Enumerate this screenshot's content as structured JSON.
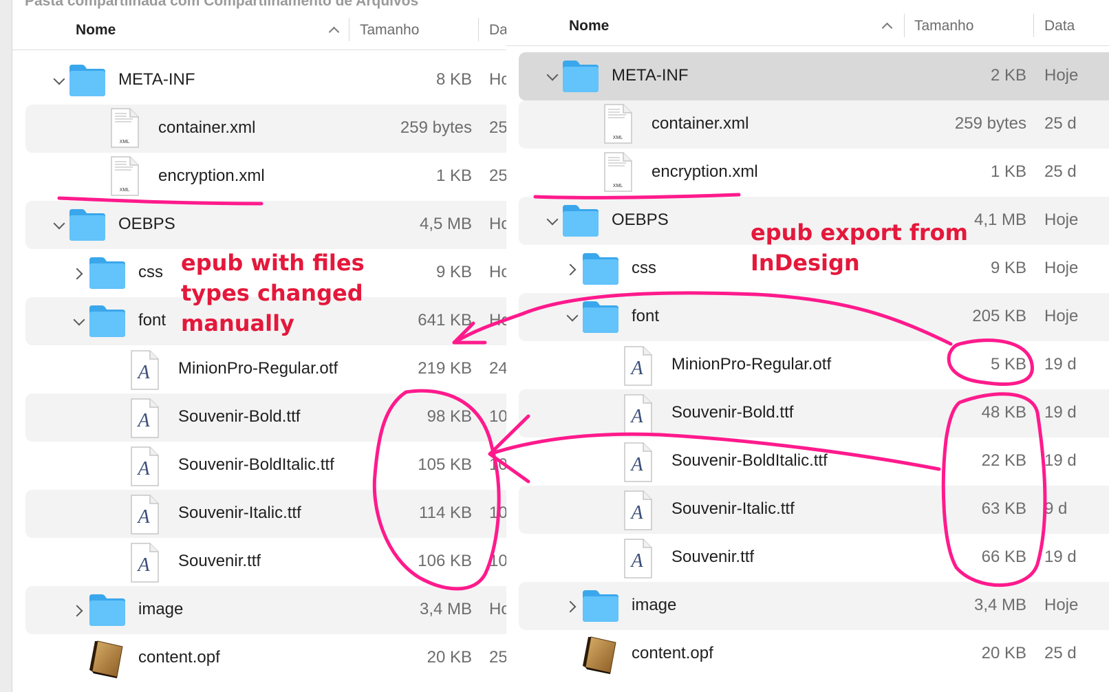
{
  "left_panel": {
    "title": "Pasta compartilhada com Compartilhamento de Arquivos",
    "columns": {
      "name": "Nome",
      "size": "Tamanho",
      "date": "Da"
    },
    "rows": [
      {
        "name": "META-INF",
        "size": "8 KB",
        "date": "Ho"
      },
      {
        "name": "container.xml",
        "size": "259 bytes",
        "date": "25"
      },
      {
        "name": "encryption.xml",
        "size": "1 KB",
        "date": "25"
      },
      {
        "name": "OEBPS",
        "size": "4,5 MB",
        "date": "Ho"
      },
      {
        "name": "css",
        "size": "9 KB",
        "date": "Ho"
      },
      {
        "name": "font",
        "size": "641 KB",
        "date": "Ho"
      },
      {
        "name": "MinionPro-Regular.otf",
        "size": "219 KB",
        "date": "24"
      },
      {
        "name": "Souvenir-Bold.ttf",
        "size": "98 KB",
        "date": "10"
      },
      {
        "name": "Souvenir-BoldItalic.ttf",
        "size": "105 KB",
        "date": "10"
      },
      {
        "name": "Souvenir-Italic.ttf",
        "size": "114 KB",
        "date": "10"
      },
      {
        "name": "Souvenir.ttf",
        "size": "106 KB",
        "date": "10"
      },
      {
        "name": "image",
        "size": "3,4 MB",
        "date": "Ho"
      },
      {
        "name": "content.opf",
        "size": "20 KB",
        "date": "25"
      }
    ]
  },
  "right_panel": {
    "columns": {
      "name": "Nome",
      "size": "Tamanho",
      "date": "Data"
    },
    "rows": [
      {
        "name": "META-INF",
        "size": "2 KB",
        "date": "Hoje"
      },
      {
        "name": "container.xml",
        "size": "259 bytes",
        "date": "25 d"
      },
      {
        "name": "encryption.xml",
        "size": "1 KB",
        "date": "25 d"
      },
      {
        "name": "OEBPS",
        "size": "4,1 MB",
        "date": "Hoje"
      },
      {
        "name": "css",
        "size": "9 KB",
        "date": "Hoje"
      },
      {
        "name": "font",
        "size": "205 KB",
        "date": "Hoje"
      },
      {
        "name": "MinionPro-Regular.otf",
        "size": "5 KB",
        "date": "19 d"
      },
      {
        "name": "Souvenir-Bold.ttf",
        "size": "48 KB",
        "date": "19 d"
      },
      {
        "name": "Souvenir-BoldItalic.ttf",
        "size": "22 KB",
        "date": "19 d"
      },
      {
        "name": "Souvenir-Italic.ttf",
        "size": "63 KB",
        "date": "9 d"
      },
      {
        "name": "Souvenir.ttf",
        "size": "66 KB",
        "date": "19 d"
      },
      {
        "name": "image",
        "size": "3,4 MB",
        "date": "Hoje"
      },
      {
        "name": "content.opf",
        "size": "20 KB",
        "date": "25 d"
      }
    ]
  },
  "annotations": {
    "left_note": [
      "epub with files",
      "types changed",
      "manually"
    ],
    "right_note": [
      "epub export from",
      "InDesign"
    ],
    "ink_color": "#ff1a8c"
  },
  "icons": {
    "folder": "folder-icon",
    "xml_file": "xml-file-icon",
    "font_file": "font-file-icon",
    "opf_file": "book-file-icon",
    "xml_badge": "XML",
    "font_glyph": "A"
  }
}
